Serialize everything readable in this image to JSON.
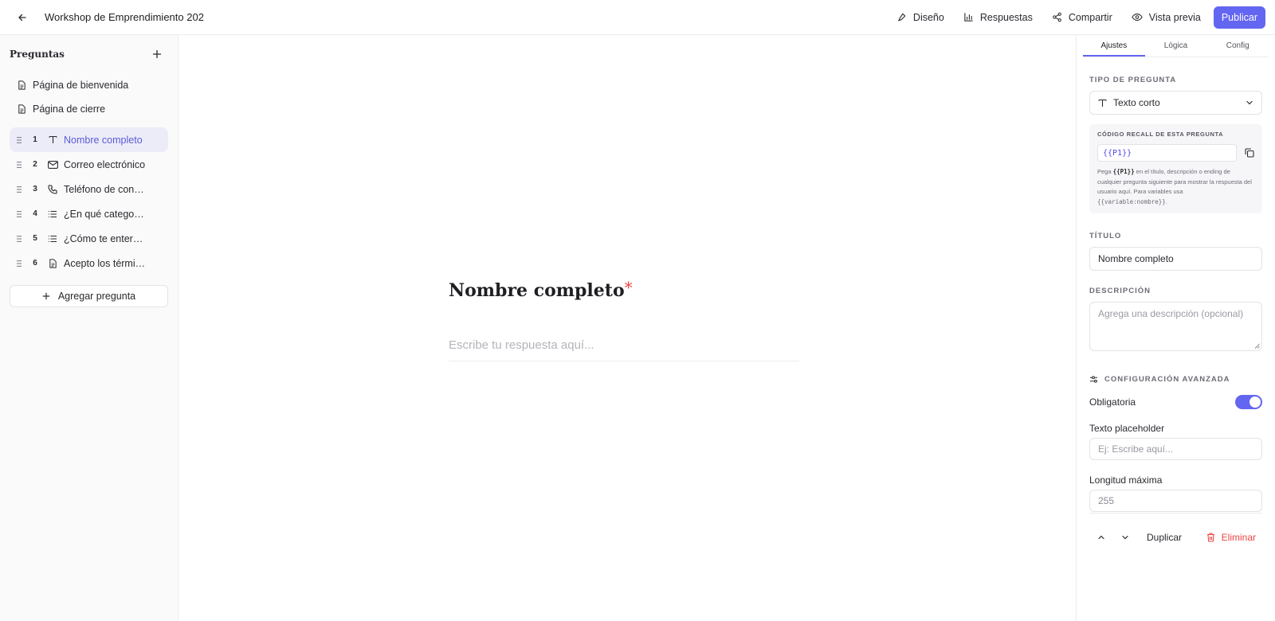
{
  "header": {
    "form_title": "Workshop de Emprendimiento 202",
    "actions": [
      {
        "label": "Diseño",
        "icon": "brush-icon"
      },
      {
        "label": "Respuestas",
        "icon": "bar-chart-icon"
      },
      {
        "label": "Compartir",
        "icon": "share-icon"
      },
      {
        "label": "Vista previa",
        "icon": "eye-icon"
      }
    ],
    "publish_label": "Publicar"
  },
  "sidebar": {
    "title": "Preguntas",
    "pages": [
      {
        "label": "Página de bienvenida"
      },
      {
        "label": "Página de cierre"
      }
    ],
    "questions": [
      {
        "num": "1",
        "label": "Nombre completo",
        "icon": "text-type-icon"
      },
      {
        "num": "2",
        "label": "Correo electrónico",
        "icon": "mail-icon"
      },
      {
        "num": "3",
        "label": "Teléfono de contacto",
        "icon": "phone-icon"
      },
      {
        "num": "4",
        "label": "¿En qué categoría se encuentra tu emprendimiento?",
        "icon": "list-icon"
      },
      {
        "num": "5",
        "label": "¿Cómo te enteraste del workshop?",
        "icon": "list-icon"
      },
      {
        "num": "6",
        "label": "Acepto los términos y condiciones",
        "icon": "document-icon"
      }
    ],
    "add_label": "Agregar pregunta"
  },
  "canvas": {
    "question_title": "Nombre completo",
    "required_mark": "*",
    "answer_placeholder": "Escribe tu respuesta aquí..."
  },
  "panel": {
    "tabs": [
      "Ajustes",
      "Lógica",
      "Config"
    ],
    "type_label": "Tipo de pregunta",
    "type_value": "Texto corto",
    "recall": {
      "label": "CÓDIGO RECALL DE ESTA PREGUNTA",
      "code": "{{P1}}",
      "help_prefix": "Pega ",
      "help_code": "{{P1}}",
      "help_middle": " en el título, descripción o ending de cualquier pregunta siguiente para mostrar la respuesta del usuario aquí. Para variables usa ",
      "help_var": "{{variable:nombre}}",
      "help_suffix": "."
    },
    "title_label": "Título",
    "title_value": "Nombre completo",
    "description_label": "Descripción",
    "description_placeholder": "Agrega una descripción (opcional)",
    "advanced_label": "Configuración avanzada",
    "required_label": "Obligatoria",
    "required_on": true,
    "placeholder_label": "Texto placeholder",
    "placeholder_hint": "Ej: Escribe aquí...",
    "maxlen_label": "Longitud máxima",
    "maxlen_value": "255",
    "duplicate_label": "Duplicar",
    "delete_label": "Eliminar"
  },
  "colors": {
    "accent": "#6366f1",
    "danger": "#ef4444",
    "active_bg": "#ececf9"
  }
}
